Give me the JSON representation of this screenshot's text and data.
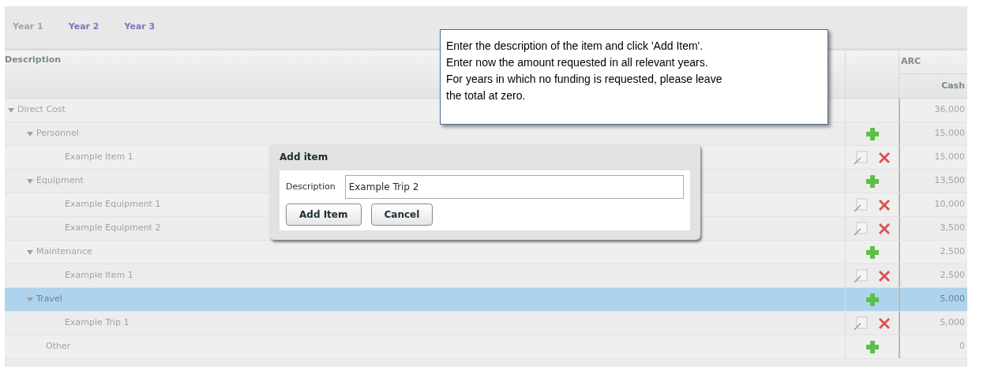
{
  "tabs": [
    {
      "label": "Year 1",
      "selected": true
    },
    {
      "label": "Year 2",
      "selected": false
    },
    {
      "label": "Year 3",
      "selected": false
    }
  ],
  "table": {
    "columns": {
      "description": "Description",
      "group": "ARC",
      "cash": "Cash"
    },
    "rows": [
      {
        "label": "Direct Cost",
        "expanded": true,
        "selected": false,
        "cash": "36,000",
        "children": [
          {
            "label": "Personnel",
            "expanded": true,
            "selected": false,
            "kind": "add",
            "cash": "15,000",
            "children": [
              {
                "label": "Example Item 1",
                "selected": false,
                "kind": "edit-delete",
                "cash": "15,000"
              }
            ]
          },
          {
            "label": "Equipment",
            "expanded": true,
            "selected": false,
            "kind": "add",
            "cash": "13,500",
            "children": [
              {
                "label": "Example Equipment 1",
                "selected": false,
                "kind": "edit-delete",
                "cash": "10,000"
              },
              {
                "label": "Example Equipment 2",
                "selected": false,
                "kind": "edit-delete",
                "cash": "3,500"
              }
            ]
          },
          {
            "label": "Maintenance",
            "expanded": true,
            "selected": false,
            "kind": "add",
            "cash": "2,500",
            "children": [
              {
                "label": "Example Item 1",
                "selected": false,
                "kind": "edit-delete",
                "cash": "2,500"
              }
            ]
          },
          {
            "label": "Travel",
            "expanded": true,
            "selected": true,
            "kind": "add",
            "cash": "5,000",
            "children": [
              {
                "label": "Example Trip 1",
                "selected": false,
                "kind": "edit-delete",
                "cash": "5,000"
              }
            ]
          },
          {
            "label": "Other",
            "selected": false,
            "kind": "add",
            "cash": "0"
          }
        ]
      }
    ]
  },
  "dialog": {
    "title": "Add item",
    "field_label": "Description",
    "value": "Example Trip 2",
    "buttons": [
      "Add Item",
      "Cancel"
    ]
  },
  "callout": {
    "lines": [
      "Enter the description of the item and click 'Add Item'.",
      "Enter now the amount requested in all relevant years.",
      "For years in which no funding is requested, please leave",
      "the total at zero."
    ]
  }
}
